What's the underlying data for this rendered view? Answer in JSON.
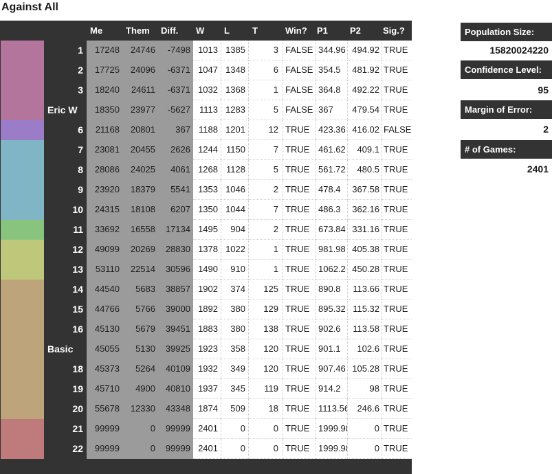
{
  "title": "Against All",
  "headers": {
    "me": "Me",
    "them": "Them",
    "diff": "Diff.",
    "w": "W",
    "l": "L",
    "t": "T",
    "win": "Win?",
    "p1": "P1",
    "p2": "P2",
    "sig": "Sig.?"
  },
  "bands": [
    {
      "from": 0,
      "to": 4,
      "color": "#b4759d"
    },
    {
      "from": 4,
      "to": 5,
      "color": "#9a7cc8"
    },
    {
      "from": 5,
      "to": 9,
      "color": "#80b5c5"
    },
    {
      "from": 9,
      "to": 10,
      "color": "#89c47e"
    },
    {
      "from": 10,
      "to": 12,
      "color": "#bfc77b"
    },
    {
      "from": 12,
      "to": 19,
      "color": "#bea47b"
    },
    {
      "from": 19,
      "to": 21,
      "color": "#bf7b7b"
    }
  ],
  "rows": [
    {
      "label": "1",
      "num": true,
      "me": "17248",
      "them": "24746",
      "diff": "-7498",
      "w": "1013",
      "l": "1385",
      "t": "3",
      "win": "FALSE",
      "p1": "344.96",
      "p2": "494.92",
      "sig": "TRUE"
    },
    {
      "label": "2",
      "num": true,
      "me": "17725",
      "them": "24096",
      "diff": "-6371",
      "w": "1047",
      "l": "1348",
      "t": "6",
      "win": "FALSE",
      "p1": "354.5",
      "p2": "481.92",
      "sig": "TRUE"
    },
    {
      "label": "3",
      "num": true,
      "me": "18240",
      "them": "24611",
      "diff": "-6371",
      "w": "1032",
      "l": "1368",
      "t": "1",
      "win": "FALSE",
      "p1": "364.8",
      "p2": "492.22",
      "sig": "TRUE"
    },
    {
      "label": "Eric W",
      "num": false,
      "me": "18350",
      "them": "23977",
      "diff": "-5627",
      "w": "1113",
      "l": "1283",
      "t": "5",
      "win": "FALSE",
      "p1": "367",
      "p2": "479.54",
      "sig": "TRUE"
    },
    {
      "label": "6",
      "num": true,
      "me": "21168",
      "them": "20801",
      "diff": "367",
      "w": "1188",
      "l": "1201",
      "t": "12",
      "win": "TRUE",
      "p1": "423.36",
      "p2": "416.02",
      "sig": "FALSE"
    },
    {
      "label": "7",
      "num": true,
      "me": "23081",
      "them": "20455",
      "diff": "2626",
      "w": "1244",
      "l": "1150",
      "t": "7",
      "win": "TRUE",
      "p1": "461.62",
      "p2": "409.1",
      "sig": "TRUE"
    },
    {
      "label": "8",
      "num": true,
      "me": "28086",
      "them": "24025",
      "diff": "4061",
      "w": "1268",
      "l": "1128",
      "t": "5",
      "win": "TRUE",
      "p1": "561.72",
      "p2": "480.5",
      "sig": "TRUE"
    },
    {
      "label": "9",
      "num": true,
      "me": "23920",
      "them": "18379",
      "diff": "5541",
      "w": "1353",
      "l": "1046",
      "t": "2",
      "win": "TRUE",
      "p1": "478.4",
      "p2": "367.58",
      "sig": "TRUE"
    },
    {
      "label": "10",
      "num": true,
      "me": "24315",
      "them": "18108",
      "diff": "6207",
      "w": "1350",
      "l": "1044",
      "t": "7",
      "win": "TRUE",
      "p1": "486.3",
      "p2": "362.16",
      "sig": "TRUE"
    },
    {
      "label": "11",
      "num": true,
      "me": "33692",
      "them": "16558",
      "diff": "17134",
      "w": "1495",
      "l": "904",
      "t": "2",
      "win": "TRUE",
      "p1": "673.84",
      "p2": "331.16",
      "sig": "TRUE"
    },
    {
      "label": "12",
      "num": true,
      "me": "49099",
      "them": "20269",
      "diff": "28830",
      "w": "1378",
      "l": "1022",
      "t": "1",
      "win": "TRUE",
      "p1": "981.98",
      "p2": "405.38",
      "sig": "TRUE"
    },
    {
      "label": "13",
      "num": true,
      "me": "53110",
      "them": "22514",
      "diff": "30596",
      "w": "1490",
      "l": "910",
      "t": "1",
      "win": "TRUE",
      "p1": "1062.2",
      "p2": "450.28",
      "sig": "TRUE"
    },
    {
      "label": "14",
      "num": true,
      "me": "44540",
      "them": "5683",
      "diff": "38857",
      "w": "1902",
      "l": "374",
      "t": "125",
      "win": "TRUE",
      "p1": "890.8",
      "p2": "113.66",
      "sig": "TRUE"
    },
    {
      "label": "15",
      "num": true,
      "me": "44766",
      "them": "5766",
      "diff": "39000",
      "w": "1892",
      "l": "380",
      "t": "129",
      "win": "TRUE",
      "p1": "895.32",
      "p2": "115.32",
      "sig": "TRUE"
    },
    {
      "label": "16",
      "num": true,
      "me": "45130",
      "them": "5679",
      "diff": "39451",
      "w": "1883",
      "l": "380",
      "t": "138",
      "win": "TRUE",
      "p1": "902.6",
      "p2": "113.58",
      "sig": "TRUE"
    },
    {
      "label": "Basic",
      "num": false,
      "me": "45055",
      "them": "5130",
      "diff": "39925",
      "w": "1923",
      "l": "358",
      "t": "120",
      "win": "TRUE",
      "p1": "901.1",
      "p2": "102.6",
      "sig": "TRUE"
    },
    {
      "label": "18",
      "num": true,
      "me": "45373",
      "them": "5264",
      "diff": "40109",
      "w": "1932",
      "l": "349",
      "t": "120",
      "win": "TRUE",
      "p1": "907.46",
      "p2": "105.28",
      "sig": "TRUE"
    },
    {
      "label": "19",
      "num": true,
      "me": "45710",
      "them": "4900",
      "diff": "40810",
      "w": "1937",
      "l": "345",
      "t": "119",
      "win": "TRUE",
      "p1": "914.2",
      "p2": "98",
      "sig": "TRUE"
    },
    {
      "label": "20",
      "num": true,
      "me": "55678",
      "them": "12330",
      "diff": "43348",
      "w": "1874",
      "l": "509",
      "t": "18",
      "win": "TRUE",
      "p1": "1113.56",
      "p2": "246.6",
      "sig": "TRUE"
    },
    {
      "label": "21",
      "num": true,
      "me": "99999",
      "them": "0",
      "diff": "99999",
      "w": "2401",
      "l": "0",
      "t": "0",
      "win": "TRUE",
      "p1": "1999.98",
      "p2": "0",
      "sig": "TRUE"
    },
    {
      "label": "22",
      "num": true,
      "me": "99999",
      "them": "0",
      "diff": "99999",
      "w": "2401",
      "l": "0",
      "t": "0",
      "win": "TRUE",
      "p1": "1999.98",
      "p2": "0",
      "sig": "TRUE"
    }
  ],
  "side": {
    "population_label": "Population Size:",
    "population_value": "15820024220",
    "confidence_label": "Confidence Level:",
    "confidence_value": "95",
    "margin_label": "Margin of Error:",
    "margin_value": "2",
    "games_label": "# of Games:",
    "games_value": "2401"
  }
}
